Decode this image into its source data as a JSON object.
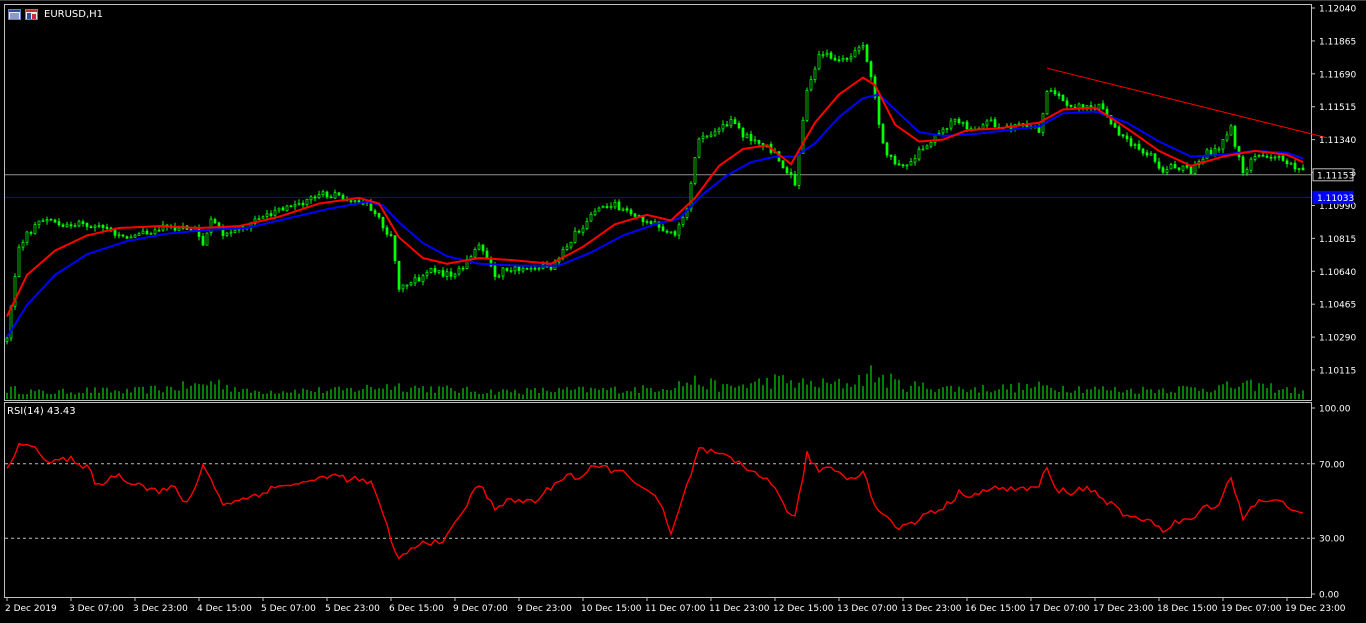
{
  "window": {
    "title": "EURUSD,H1"
  },
  "colors": {
    "background": "#000000",
    "frame": "#c0c0c0",
    "candle": "#00ff00",
    "volume": "#00ff00",
    "ma_fast": "#ff0000",
    "ma_slow": "#0000ff",
    "rsi": "#ff0000",
    "trendline": "#ff0000",
    "hline_gray": "#c0c0c0",
    "hline_blue": "#0000ff",
    "bid_tag": "#000000",
    "ask_tag": "#0000ff"
  },
  "icons": [
    "chart-window-icon",
    "indicator-window-icon"
  ],
  "chart_data": [
    {
      "type": "candlestick",
      "title": "EURUSD,H1",
      "y_ticks": [
        "1.12040",
        "1.11865",
        "1.11690",
        "1.11515",
        "1.11340",
        "1.11165",
        "1.10990",
        "1.10815",
        "1.10640",
        "1.10465",
        "1.10290",
        "1.10115"
      ],
      "ylim": [
        1.1003,
        1.1207
      ],
      "price_tags": [
        "1.11153",
        "1.11033"
      ],
      "x_ticks": [
        "2 Dec 2019",
        "3 Dec 07:00",
        "3 Dec 23:00",
        "4 Dec 15:00",
        "5 Dec 07:00",
        "5 Dec 23:00",
        "6 Dec 15:00",
        "9 Dec 07:00",
        "9 Dec 23:00",
        "10 Dec 15:00",
        "11 Dec 07:00",
        "11 Dec 23:00",
        "12 Dec 15:00",
        "13 Dec 07:00",
        "13 Dec 23:00",
        "16 Dec 15:00",
        "17 Dec 07:00",
        "17 Dec 23:00",
        "18 Dec 15:00",
        "19 Dec 07:00",
        "19 Dec 23:00"
      ],
      "close_keypoints": [
        [
          0,
          1.1027
        ],
        [
          3,
          1.1078
        ],
        [
          8,
          1.1091
        ],
        [
          14,
          1.1089
        ],
        [
          22,
          1.1089
        ],
        [
          30,
          1.1082
        ],
        [
          38,
          1.1087
        ],
        [
          44,
          1.1087
        ],
        [
          47,
          1.1086
        ],
        [
          49,
          1.1079
        ],
        [
          51,
          1.1091
        ],
        [
          54,
          1.1083
        ],
        [
          60,
          1.1088
        ],
        [
          66,
          1.1095
        ],
        [
          72,
          1.1099
        ],
        [
          78,
          1.1105
        ],
        [
          84,
          1.1104
        ],
        [
          90,
          1.11
        ],
        [
          93,
          1.1092
        ],
        [
          96,
          1.1082
        ],
        [
          98,
          1.1055
        ],
        [
          101,
          1.1058
        ],
        [
          106,
          1.1064
        ],
        [
          112,
          1.1062
        ],
        [
          118,
          1.1078
        ],
        [
          122,
          1.1062
        ],
        [
          126,
          1.1066
        ],
        [
          130,
          1.1066
        ],
        [
          136,
          1.1066
        ],
        [
          142,
          1.1084
        ],
        [
          148,
          1.1098
        ],
        [
          152,
          1.1099
        ],
        [
          156,
          1.1095
        ],
        [
          160,
          1.1091
        ],
        [
          164,
          1.1087
        ],
        [
          167,
          1.1085
        ],
        [
          170,
          1.1096
        ],
        [
          173,
          1.1136
        ],
        [
          176,
          1.1137
        ],
        [
          181,
          1.1143
        ],
        [
          186,
          1.1133
        ],
        [
          190,
          1.1131
        ],
        [
          193,
          1.1124
        ],
        [
          197,
          1.1111
        ],
        [
          200,
          1.1159
        ],
        [
          203,
          1.118
        ],
        [
          207,
          1.1178
        ],
        [
          210,
          1.1176
        ],
        [
          214,
          1.1184
        ],
        [
          216,
          1.1169
        ],
        [
          219,
          1.1131
        ],
        [
          222,
          1.112
        ],
        [
          225,
          1.1119
        ],
        [
          229,
          1.113
        ],
        [
          233,
          1.1138
        ],
        [
          237,
          1.1145
        ],
        [
          241,
          1.1139
        ],
        [
          246,
          1.1143
        ],
        [
          250,
          1.114
        ],
        [
          254,
          1.1143
        ],
        [
          258,
          1.1138
        ],
        [
          260,
          1.116
        ],
        [
          262,
          1.1158
        ],
        [
          266,
          1.1152
        ],
        [
          270,
          1.1152
        ],
        [
          274,
          1.1151
        ],
        [
          278,
          1.1137
        ],
        [
          282,
          1.1131
        ],
        [
          286,
          1.1126
        ],
        [
          289,
          1.1117
        ],
        [
          292,
          1.112
        ],
        [
          296,
          1.1117
        ],
        [
          300,
          1.1127
        ],
        [
          303,
          1.113
        ],
        [
          306,
          1.114
        ],
        [
          309,
          1.1115
        ],
        [
          312,
          1.1126
        ],
        [
          316,
          1.1126
        ],
        [
          320,
          1.1122
        ],
        [
          324,
          1.1118
        ]
      ],
      "ma_fast_keypoints": [
        [
          0,
          1.104
        ],
        [
          5,
          1.1062
        ],
        [
          12,
          1.1075
        ],
        [
          20,
          1.1083
        ],
        [
          28,
          1.1087
        ],
        [
          38,
          1.1088
        ],
        [
          48,
          1.1087
        ],
        [
          58,
          1.1088
        ],
        [
          68,
          1.1093
        ],
        [
          78,
          1.11
        ],
        [
          88,
          1.1103
        ],
        [
          93,
          1.11
        ],
        [
          98,
          1.1082
        ],
        [
          104,
          1.1071
        ],
        [
          110,
          1.1068
        ],
        [
          118,
          1.1071
        ],
        [
          126,
          1.107
        ],
        [
          136,
          1.1068
        ],
        [
          144,
          1.1077
        ],
        [
          152,
          1.1089
        ],
        [
          160,
          1.1094
        ],
        [
          166,
          1.1091
        ],
        [
          172,
          1.1103
        ],
        [
          178,
          1.112
        ],
        [
          184,
          1.1129
        ],
        [
          190,
          1.1131
        ],
        [
          196,
          1.1121
        ],
        [
          202,
          1.1143
        ],
        [
          208,
          1.1158
        ],
        [
          214,
          1.1167
        ],
        [
          217,
          1.1163
        ],
        [
          222,
          1.1142
        ],
        [
          228,
          1.1133
        ],
        [
          234,
          1.1134
        ],
        [
          240,
          1.1139
        ],
        [
          248,
          1.114
        ],
        [
          258,
          1.1143
        ],
        [
          264,
          1.115
        ],
        [
          272,
          1.1151
        ],
        [
          280,
          1.114
        ],
        [
          288,
          1.1128
        ],
        [
          296,
          1.112
        ],
        [
          304,
          1.1125
        ],
        [
          312,
          1.1128
        ],
        [
          320,
          1.1126
        ],
        [
          324,
          1.1122
        ]
      ],
      "ma_slow_keypoints": [
        [
          0,
          1.1029
        ],
        [
          5,
          1.1046
        ],
        [
          12,
          1.1062
        ],
        [
          20,
          1.1073
        ],
        [
          30,
          1.108
        ],
        [
          40,
          1.1084
        ],
        [
          50,
          1.1086
        ],
        [
          60,
          1.1087
        ],
        [
          70,
          1.1092
        ],
        [
          80,
          1.1097
        ],
        [
          90,
          1.1101
        ],
        [
          94,
          1.1099
        ],
        [
          98,
          1.109
        ],
        [
          104,
          1.1079
        ],
        [
          110,
          1.1072
        ],
        [
          118,
          1.1068
        ],
        [
          128,
          1.1067
        ],
        [
          138,
          1.1067
        ],
        [
          146,
          1.1074
        ],
        [
          154,
          1.1083
        ],
        [
          162,
          1.1089
        ],
        [
          168,
          1.1092
        ],
        [
          174,
          1.1105
        ],
        [
          180,
          1.1115
        ],
        [
          186,
          1.1122
        ],
        [
          192,
          1.1125
        ],
        [
          197,
          1.1125
        ],
        [
          202,
          1.1132
        ],
        [
          208,
          1.1146
        ],
        [
          214,
          1.1156
        ],
        [
          218,
          1.1158
        ],
        [
          222,
          1.115
        ],
        [
          228,
          1.1138
        ],
        [
          234,
          1.1136
        ],
        [
          242,
          1.1137
        ],
        [
          250,
          1.1139
        ],
        [
          258,
          1.1141
        ],
        [
          264,
          1.1148
        ],
        [
          272,
          1.1149
        ],
        [
          280,
          1.1143
        ],
        [
          288,
          1.1133
        ],
        [
          296,
          1.1125
        ],
        [
          304,
          1.1126
        ],
        [
          312,
          1.1128
        ],
        [
          320,
          1.1127
        ],
        [
          324,
          1.1124
        ]
      ],
      "volume_keypoints": [
        [
          0,
          0.4
        ],
        [
          10,
          0.25
        ],
        [
          20,
          0.35
        ],
        [
          30,
          0.3
        ],
        [
          48,
          0.55
        ],
        [
          52,
          0.7
        ],
        [
          60,
          0.3
        ],
        [
          72,
          0.35
        ],
        [
          84,
          0.35
        ],
        [
          96,
          0.55
        ],
        [
          104,
          0.45
        ],
        [
          120,
          0.3
        ],
        [
          140,
          0.35
        ],
        [
          160,
          0.4
        ],
        [
          172,
          0.7
        ],
        [
          180,
          0.45
        ],
        [
          192,
          0.75
        ],
        [
          200,
          0.6
        ],
        [
          210,
          0.6
        ],
        [
          216,
          1.0
        ],
        [
          224,
          0.55
        ],
        [
          240,
          0.4
        ],
        [
          260,
          0.5
        ],
        [
          280,
          0.35
        ],
        [
          300,
          0.45
        ],
        [
          312,
          0.55
        ],
        [
          324,
          0.3
        ]
      ],
      "trendline": {
        "from": [
          260,
          1.1172
        ],
        "to": [
          330,
          1.1135
        ]
      },
      "hlines": [
        1.11153,
        1.11033
      ]
    },
    {
      "type": "line",
      "title": "RSI(14) 43.43",
      "y_ticks": [
        "100.00",
        "70.00",
        "30.00",
        "0.00"
      ],
      "ylim": [
        0,
        100
      ],
      "levels": [
        70,
        30
      ],
      "rsi_keypoints": [
        [
          0,
          69
        ],
        [
          3,
          79
        ],
        [
          7,
          81
        ],
        [
          10,
          71
        ],
        [
          16,
          72
        ],
        [
          18,
          68
        ],
        [
          20,
          71
        ],
        [
          22,
          58
        ],
        [
          27,
          64
        ],
        [
          32,
          60
        ],
        [
          38,
          55
        ],
        [
          42,
          57
        ],
        [
          45,
          48
        ],
        [
          47,
          57
        ],
        [
          48,
          64
        ],
        [
          49,
          70
        ],
        [
          51,
          61
        ],
        [
          54,
          49
        ],
        [
          58,
          50
        ],
        [
          64,
          55
        ],
        [
          70,
          59
        ],
        [
          76,
          60
        ],
        [
          80,
          64
        ],
        [
          88,
          61
        ],
        [
          91,
          60
        ],
        [
          94,
          42
        ],
        [
          96,
          30
        ],
        [
          98,
          18
        ],
        [
          101,
          24
        ],
        [
          104,
          27
        ],
        [
          110,
          30
        ],
        [
          114,
          45
        ],
        [
          118,
          59
        ],
        [
          122,
          47
        ],
        [
          126,
          50
        ],
        [
          132,
          50
        ],
        [
          136,
          57
        ],
        [
          140,
          65
        ],
        [
          143,
          62
        ],
        [
          146,
          67
        ],
        [
          150,
          68
        ],
        [
          156,
          63
        ],
        [
          160,
          56
        ],
        [
          164,
          46
        ],
        [
          166,
          31
        ],
        [
          170,
          58
        ],
        [
          173,
          78
        ],
        [
          176,
          76
        ],
        [
          181,
          72
        ],
        [
          186,
          66
        ],
        [
          190,
          63
        ],
        [
          193,
          52
        ],
        [
          197,
          40
        ],
        [
          200,
          75
        ],
        [
          203,
          66
        ],
        [
          206,
          69
        ],
        [
          210,
          62
        ],
        [
          214,
          66
        ],
        [
          217,
          48
        ],
        [
          222,
          36
        ],
        [
          226,
          37
        ],
        [
          230,
          44
        ],
        [
          234,
          46
        ],
        [
          238,
          54
        ],
        [
          242,
          54
        ],
        [
          246,
          56
        ],
        [
          250,
          57
        ],
        [
          254,
          56
        ],
        [
          258,
          58
        ],
        [
          260,
          68
        ],
        [
          262,
          56
        ],
        [
          266,
          55
        ],
        [
          270,
          57
        ],
        [
          274,
          52
        ],
        [
          278,
          44
        ],
        [
          282,
          40
        ],
        [
          286,
          41
        ],
        [
          289,
          33
        ],
        [
          292,
          38
        ],
        [
          296,
          40
        ],
        [
          300,
          47
        ],
        [
          303,
          49
        ],
        [
          306,
          63
        ],
        [
          309,
          41
        ],
        [
          312,
          49
        ],
        [
          316,
          50
        ],
        [
          320,
          48
        ],
        [
          323,
          45
        ]
      ]
    }
  ]
}
